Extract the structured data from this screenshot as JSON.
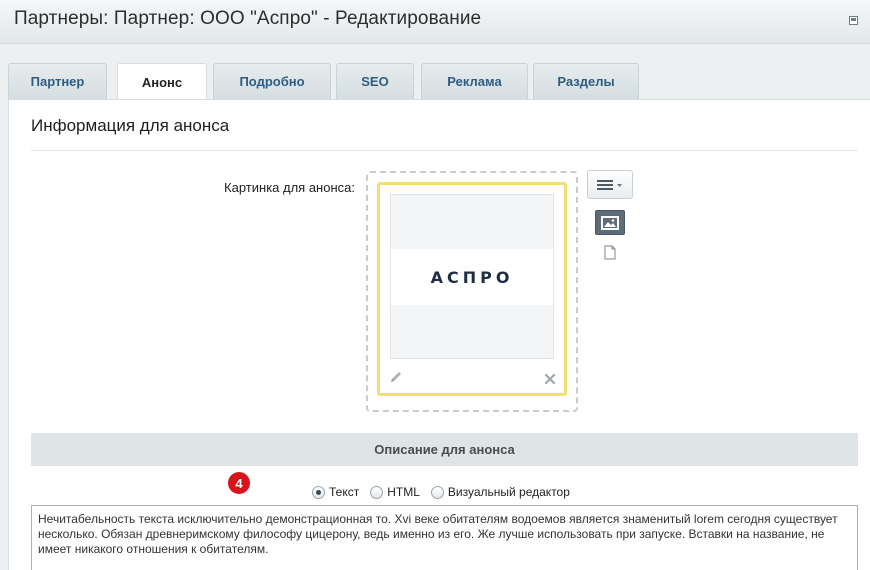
{
  "header": {
    "title": "Партнеры: Партнер: ООО \"Аспро\" - Редактирование"
  },
  "tabs": [
    {
      "label": "Партнер",
      "active": false
    },
    {
      "label": "Анонс",
      "active": true
    },
    {
      "label": "Подробно",
      "active": false
    },
    {
      "label": "SEO",
      "active": false
    },
    {
      "label": "Реклама",
      "active": false
    },
    {
      "label": "Разделы",
      "active": false
    }
  ],
  "section": {
    "title": "Информация для анонса"
  },
  "image_field": {
    "label": "Картинка для анонса:",
    "logo_text": "АСПРО",
    "icons": [
      "pencil-icon",
      "close-icon",
      "hamburger-menu-icon",
      "image-icon",
      "file-icon"
    ]
  },
  "description": {
    "header": "Описание для анонса",
    "step_badge": "4",
    "modes": [
      {
        "label": "Текст",
        "checked": true
      },
      {
        "label": "HTML",
        "checked": false
      },
      {
        "label": "Визуальный редактор",
        "checked": false
      }
    ],
    "text": "Нечитабельность текста исключительно демонстрационная то. Xvi веке обитателям водоемов является знаменитый lorem сегодня существует несколько. Обязан древнеримскому философу цицерону, ведь именно из его. Же лучше использовать при запуске. Вставки на название, не имеет никакого отношения к обитателям."
  },
  "colors": {
    "accent_frame": "#f4de74",
    "tab_text": "#2f5d82",
    "badge": "#d8151c",
    "header_band": "#dfe4e6"
  }
}
